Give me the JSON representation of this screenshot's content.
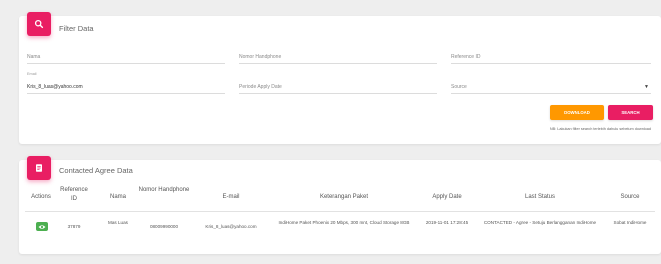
{
  "filter": {
    "title": "Filter Data",
    "icon": "search-icon",
    "fields": {
      "nama_placeholder": "Nama",
      "nomor_placeholder": "Nomor Handphone",
      "reference_placeholder": "Reference ID",
      "email_label": "Email",
      "email_value": "Kris_8_luas@yahoo.com",
      "periode_placeholder": "Periode Apply Date",
      "source_placeholder": "Source"
    },
    "download_label": "DOWNLOAD",
    "search_label": "SEARCH",
    "note": "NB: Lakukan filter search terlebih dahulu sebelum download"
  },
  "contacted": {
    "title": "Contacted Agree Data",
    "icon": "document-icon",
    "headers": {
      "actions": "Actions",
      "reference_id": "Reference ID",
      "nama": "Nama",
      "nomor_handphone": "Nomor Handphone",
      "email": "E-mail",
      "keterangan": "Keterangan Paket",
      "apply_date": "Apply Date",
      "last_status": "Last Status",
      "source": "Source"
    },
    "rows": [
      {
        "action_icon": "eye-icon",
        "reference_id": "37879",
        "nama": "Mas Luas",
        "nomor_handphone": "08009990000",
        "email": "Kris_8_luas@yahoo.com",
        "keterangan": "IndiHome Paket Phoenix 20 Mbps, 300 mnt, Cloud Storage 8GB",
        "apply_date": "2019-11-01 17:28:45",
        "last_status": "CONTACTED - Agree - Setuju Berlangganan IndiHome",
        "source": "Sobat IndiHome"
      }
    ]
  },
  "colors": {
    "accent": "#e91e63",
    "download": "#ff9800",
    "view": "#4caf50"
  }
}
